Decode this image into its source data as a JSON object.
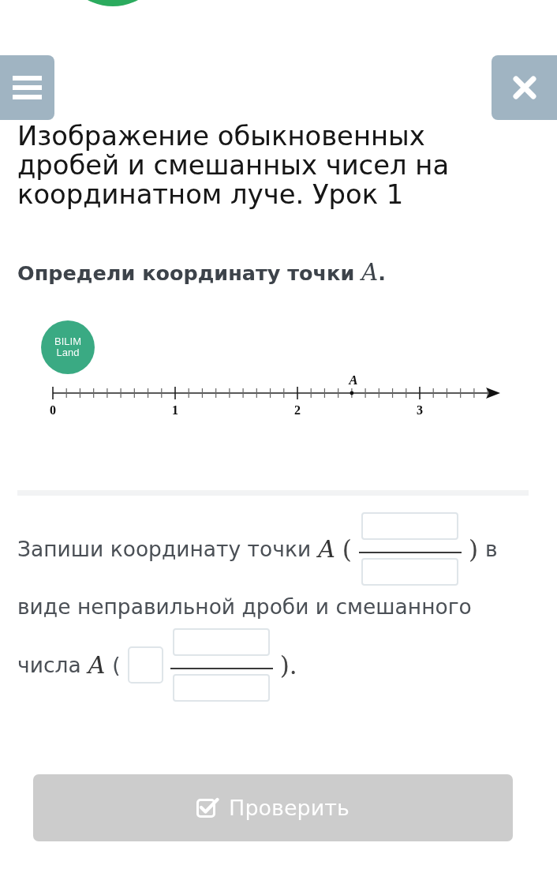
{
  "lesson_title": "Изображение обыкновенных дробей и смешанных чисел на координатном луче. Урок 1",
  "question": "Определи координату точки *A*.",
  "figure": {
    "logo": "BILIM Land",
    "tick_labels": [
      "0",
      "1",
      "2",
      "3"
    ],
    "point_label": "A"
  },
  "answer": {
    "parts": [
      {
        "kind": "text",
        "text": "Запиши координату точки"
      },
      {
        "kind": "math",
        "text": "A"
      },
      {
        "kind": "paren",
        "text": "("
      },
      {
        "kind": "fraction"
      },
      {
        "kind": "paren",
        "text": ")"
      },
      {
        "kind": "text",
        "text": "в"
      },
      {
        "kind": "text",
        "text": "виде неправильной дроби и смешанного"
      },
      {
        "kind": "text",
        "text": "числа"
      },
      {
        "kind": "math",
        "text": "A"
      },
      {
        "kind": "text",
        "text": "("
      },
      {
        "kind": "whole"
      },
      {
        "kind": "fraction"
      },
      {
        "kind": "paren",
        "text": ")."
      }
    ]
  },
  "check_button": {
    "label": "Проверить",
    "disabled": true
  }
}
